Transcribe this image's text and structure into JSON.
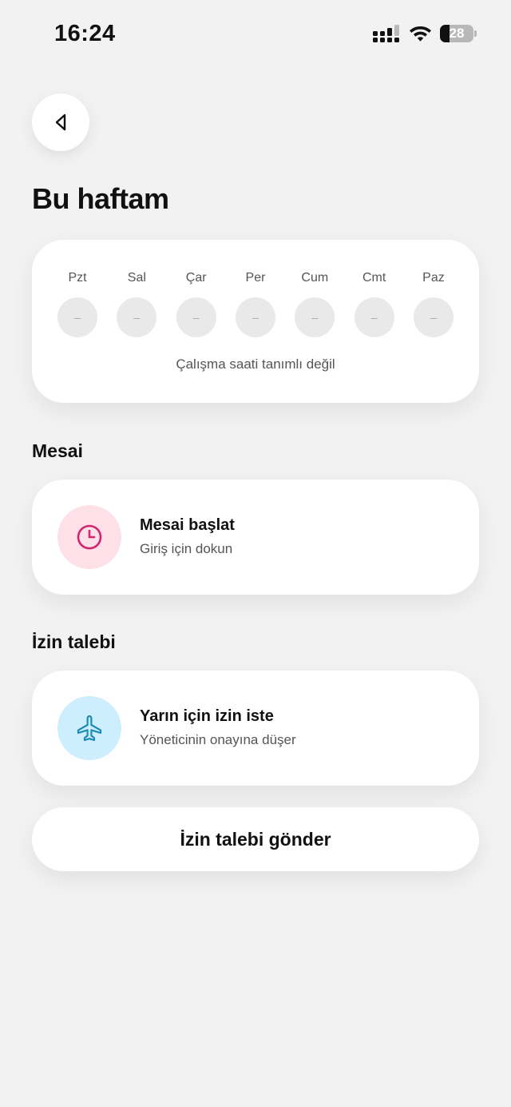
{
  "status_bar": {
    "time": "16:24",
    "battery_level": "28",
    "battery_fraction": 0.28,
    "icons": [
      "signal-icon",
      "wifi-icon",
      "battery-icon"
    ]
  },
  "back_button": {
    "icon": "chevron-left-icon"
  },
  "page_title": "Bu haftam",
  "week": {
    "days": [
      {
        "label": "Pzt",
        "value": "–"
      },
      {
        "label": "Sal",
        "value": "–"
      },
      {
        "label": "Çar",
        "value": "–"
      },
      {
        "label": "Per",
        "value": "–"
      },
      {
        "label": "Cum",
        "value": "–"
      },
      {
        "label": "Cmt",
        "value": "–"
      },
      {
        "label": "Paz",
        "value": "–"
      }
    ],
    "note": "Çalışma saati tanımlı değil"
  },
  "mesai": {
    "section_title": "Mesai",
    "action_title": "Mesai başlat",
    "action_subtitle": "Giriş için dokun",
    "icon": "clock-icon",
    "icon_color": "#d6256f",
    "icon_bg": "#fde0e8"
  },
  "izin": {
    "section_title": "İzin talebi",
    "action_title": "Yarın için izin iste",
    "action_subtitle": "Yöneticinin onayına düşer",
    "icon": "airplane-icon",
    "icon_color": "#1a8cb8",
    "icon_bg": "#cdeefc",
    "submit_label": "İzin talebi gönder"
  }
}
